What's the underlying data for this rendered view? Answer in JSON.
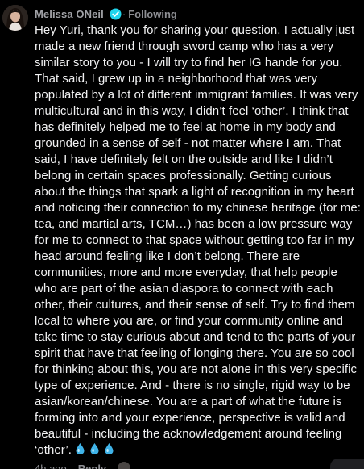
{
  "comment": {
    "author": "Melissa ONeil",
    "verified": true,
    "following_label": "Following",
    "separator": "·",
    "body": "Hey Yuri, thank you for sharing your question. I actually just made a new friend through sword camp who has a very similar story to you - I will try to find her IG hande for you. That said, I grew up in a neighborhood that was very populated by a lot of different immigrant families. It was very multicultural and in this way, I didn’t feel ‘other’. I think that has definitely helped me to feel at home in my body and grounded in a sense of self - not matter where I am. That said, I have definitely felt on the outside and like I didn’t belong in certain spaces professionally. Getting curious about the things that spark a light of recognition in my heart and noticing their connection to my chinese heritage (for me: tea, and martial arts, TCM…) has been a low pressure way for me to connect to that space without getting too far in my head around feeling like I don’t belong. There are communities, more and more everyday, that help people who are part of the asian diaspora to connect with each other, their cultures, and their sense of self. Try to find them local to where you are, or find your community online and take time to stay curious about and tend to the parts of your spirit that have that feeling of longing there. You are so cool for thinking about this, you are not alone in this very specific type of experience. And - there is no single, rigid way to be asian/korean/chinese. You are a part of what the future is forming into and your experience, perspective is valid and beautiful - including the acknowledgement around feeling ‘other’.",
    "emoji": [
      "droplet-icon",
      "droplet-icon",
      "droplet-icon"
    ],
    "age": "4h ago",
    "reply_label": "Reply"
  },
  "colors": {
    "background": "#000000",
    "text": "#f1f1f2",
    "muted": "#a1a2a7",
    "verified": "#20d5ec",
    "droplet": "#3fb3e8"
  }
}
